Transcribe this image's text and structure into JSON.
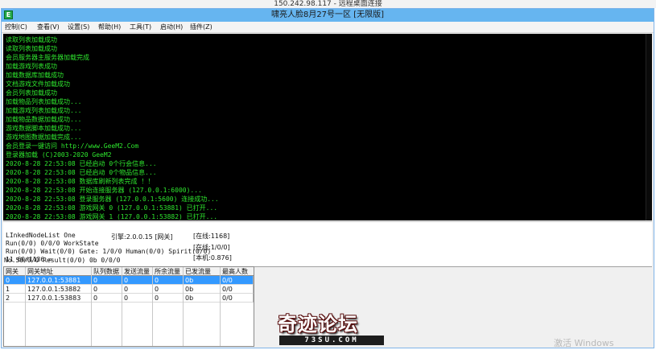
{
  "remote_bar": {
    "title": "150.242.98.117 - 远程桌面连接"
  },
  "window": {
    "icon": "E",
    "title": "啸亮人脸8月27号一区 [无限版]"
  },
  "menu": [
    {
      "label": "控制(C)"
    },
    {
      "label": "查看(V)"
    },
    {
      "label": "设置(S)"
    },
    {
      "label": "帮助(H)"
    },
    {
      "label": "工具(T)"
    },
    {
      "label": "启动(H)"
    },
    {
      "label": "插件(Z)"
    }
  ],
  "colors": {
    "console_bg": "#000000",
    "log_text": "#2ee62e",
    "titlebar": "#66b5f0",
    "selection": "#3399ff"
  },
  "console_lines": [
    "读取列表加载成功",
    "读取列表加载成功",
    "会员服务器主服务器加载完成",
    "加载游戏列表成功",
    "加载数据库加载成功",
    "文档游戏文件加载成功",
    "会员列表加载成功",
    "加载物品列表加载成功...",
    "加载游戏列表加载成功...",
    "加载物品数据加载成功...",
    "游戏数据脚本加载成功...",
    "游戏地图数据加载完成...",
    "会员登录一键访问 http://www.GeeM2.Com",
    "登录器加载 (C)2003-2020 GeeM2",
    "2020-8-28 22:53:08 已经启动 0个行会信息...",
    "2020-8-28 22:53:08 已经启动 0个物品信息...",
    "2020-8-28 22:53:08 数据库刷新列表完成 ！！",
    "2020-8-28 22:53:08 开始连接服务器 (127.0.0.1:6000)...",
    "2020-8-28 22:53:08 登录服务器 (127.0.0.1:5600) 连接成功...",
    "2020-8-28 22:53:08 游戏网关 0 (127.0.0.1:53881) 已打开...",
    "2020-8-28 22:53:08 游戏网关 1 (127.0.0.1:53882) 已打开..."
  ],
  "status": {
    "left_lines": [
      "LInkedNodeList One",
      "Run(0/0) 0/0/0 WorkState",
      "Run(0/0) Wait(0/0) Gate: 1/0/0 Human(0/0) Spirit(0/0)",
      "11 60/1136 =",
      "No.50/0/0 Result(0/0) 0b 0/0/0"
    ],
    "mid": "引擎:2.0.0.15 [网关]",
    "right_lines": [
      "[在线:1168]",
      "[在线:1/0/0]",
      "[本机:0.876]"
    ]
  },
  "gate_table": {
    "columns": [
      "网关",
      "网关地址",
      "队列数据",
      "发送流量",
      "所余流量",
      "已发流量",
      "最高人数"
    ],
    "rows": [
      [
        "0",
        "127.0.0.1:53881",
        "0",
        "0",
        "0",
        "0b",
        "0/0"
      ],
      [
        "1",
        "127.0.0.1:53882",
        "0",
        "0",
        "0",
        "0b",
        "0/0"
      ],
      [
        "2",
        "127.0.0.1:53883",
        "0",
        "0",
        "0",
        "0b",
        "0/0"
      ]
    ],
    "selected_row": 0
  },
  "watermark": {
    "title": "奇迹论坛",
    "subtitle": "73SU.COM"
  },
  "activation": {
    "text": "激活 Windows"
  }
}
